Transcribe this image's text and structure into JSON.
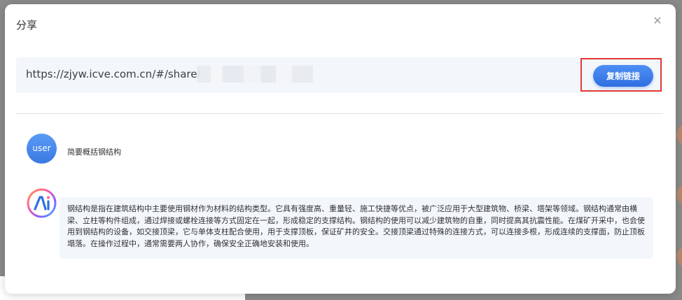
{
  "dialog": {
    "title": "分享",
    "close_icon": "close-icon"
  },
  "share": {
    "link_visible": "https://zjyw.icve.com.cn/#/share/",
    "copy_label": "复制链接"
  },
  "chat": {
    "user_avatar_label": "user",
    "user_message": "简要概括钢结构",
    "ai_avatar_icon": "ai-logo-icon",
    "ai_message": "钢结构是指在建筑结构中主要使用钢材作为材料的结构类型。它具有强度高、重量轻、施工快捷等优点，被广泛应用于大型建筑物、桥梁、塔架等领域。钢结构通常由横梁、立柱等构件组成，通过焊接或螺栓连接等方式固定在一起，形成稳定的支撑结构。钢结构的使用可以减少建筑物的自重，同时提高其抗震性能。在煤矿开采中，也会使用到钢结构的设备，如交接顶梁，它与单体支柱配合使用，用于支撑顶板，保证矿井的安全。交接顶梁通过特殊的连接方式，可以连接多根，形成连续的支撑面，防止顶板塌落。在操作过程中，通常需要两人协作，确保安全正确地安装和使用。"
  },
  "colors": {
    "accent": "#3a7be6",
    "highlight_border": "#e53935",
    "bubble_bg": "#f3f7fc"
  }
}
